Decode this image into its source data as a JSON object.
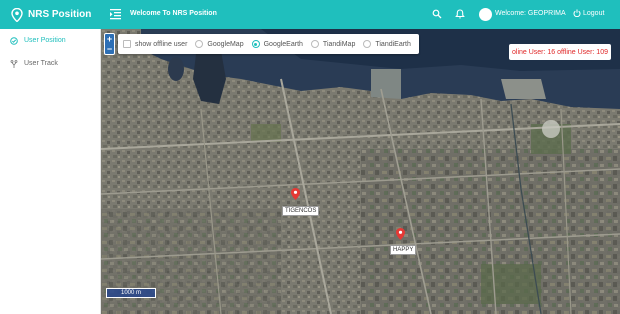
{
  "header": {
    "brand_title": "NRS Position",
    "welcome_title": "Welcome To NRS Position",
    "user_label": "Welcome: GEOPRIMA",
    "logout_label": "Logout",
    "accent_color": "#1fbfbd"
  },
  "sidebar": {
    "items": [
      {
        "label": "User Position",
        "icon": "check-circle-icon",
        "active": true
      },
      {
        "label": "User Track",
        "icon": "track-icon",
        "active": false
      }
    ]
  },
  "map": {
    "zoom_in": "+",
    "zoom_out": "−",
    "options": {
      "show_offline_label": "show offline user",
      "show_offline_checked": false,
      "layers": [
        {
          "label": "GoogleMap",
          "selected": false
        },
        {
          "label": "GoogleEarth",
          "selected": true
        },
        {
          "label": "TiandiMap",
          "selected": false
        },
        {
          "label": "TiandiEarth",
          "selected": false
        }
      ]
    },
    "online_status": "oline User: 16 offline User: 109",
    "markers": [
      {
        "label": "TIGENCOS"
      },
      {
        "label": "HAPPY"
      }
    ],
    "scale_label": "1000 m",
    "marker_color": "#e53935"
  }
}
